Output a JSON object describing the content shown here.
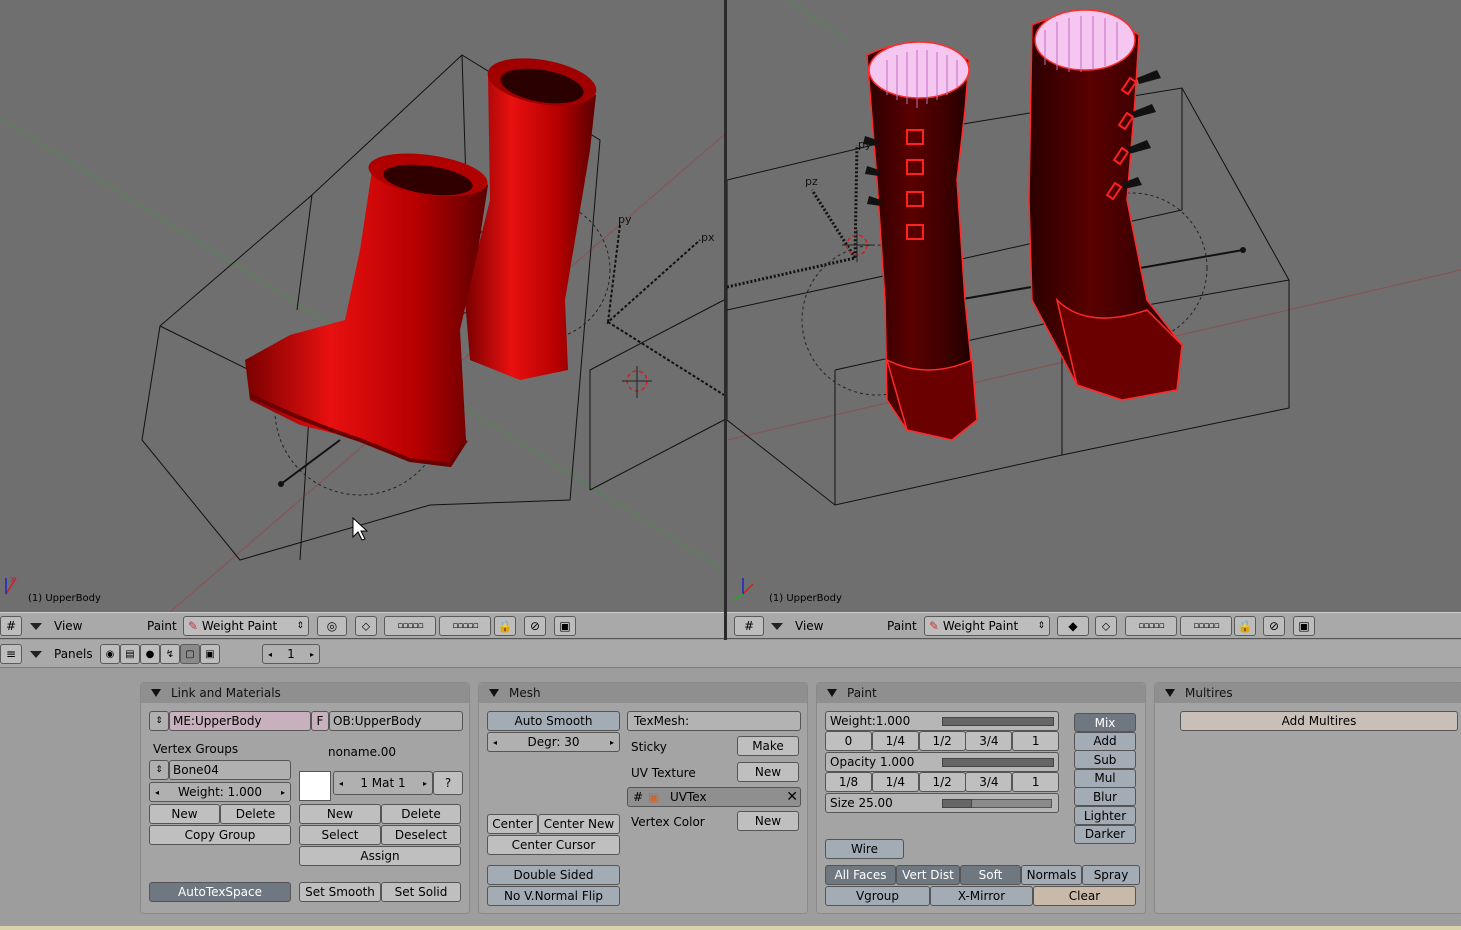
{
  "viewport_left": {
    "label": "(1) UpperBody",
    "axis_py": "py",
    "axis_px": "px"
  },
  "viewport_right": {
    "label": "(1) UpperBody",
    "axis_py": "py",
    "axis_pz": "pz"
  },
  "header_left": {
    "view": "View",
    "mode_label": "Paint",
    "mode_value": "Weight Paint"
  },
  "header_right": {
    "view": "View",
    "mode_label": "Paint",
    "mode_value": "Weight Paint"
  },
  "buttons_header": {
    "panels": "Panels",
    "frame": "1"
  },
  "link_materials": {
    "title": "Link and Materials",
    "mesh": "ME:UpperBody",
    "f": "F",
    "object": "OB:UpperBody",
    "vgroups_label": "Vertex Groups",
    "material_name": "noname.00",
    "group": "Bone04",
    "weight": "Weight: 1.000",
    "mat": "1 Mat 1",
    "q": "?",
    "new": "New",
    "delete": "Delete",
    "copy_group": "Copy Group",
    "mat_new": "New",
    "mat_delete": "Delete",
    "select": "Select",
    "deselect": "Deselect",
    "assign": "Assign",
    "autotex": "AutoTexSpace",
    "set_smooth": "Set Smooth",
    "set_solid": "Set Solid"
  },
  "mesh": {
    "title": "Mesh",
    "auto_smooth": "Auto Smooth",
    "degr": "Degr: 30",
    "texmesh": "TexMesh:",
    "sticky": "Sticky",
    "make": "Make",
    "uv_texture": "UV Texture",
    "uv_new": "New",
    "uvtex": "UVTex",
    "vertex_color": "Vertex Color",
    "vc_new": "New",
    "center": "Center",
    "center_new": "Center New",
    "center_cursor": "Center Cursor",
    "double_sided": "Double Sided",
    "no_vnormal": "No V.Normal Flip"
  },
  "paint": {
    "title": "Paint",
    "weight": "Weight:1.000",
    "weight_val": 1.0,
    "w_presets": [
      "0",
      "1/4",
      "1/2",
      "3/4",
      "1"
    ],
    "opacity": "Opacity 1.000",
    "opacity_val": 1.0,
    "o_presets": [
      "1/8",
      "1/4",
      "1/2",
      "3/4",
      "1"
    ],
    "size": "Size 25.00",
    "size_val": 0.27,
    "modes": [
      "Mix",
      "Add",
      "Sub",
      "Mul",
      "Blur",
      "Lighter",
      "Darker"
    ],
    "wire": "Wire",
    "opts": [
      "All Faces",
      "Vert Dist",
      "Soft",
      "Normals",
      "Spray"
    ],
    "vgroup": "Vgroup",
    "xmirror": "X-Mirror",
    "clear": "Clear"
  },
  "multires": {
    "title": "Multires",
    "add": "Add Multires"
  },
  "colors": {
    "viewport": "#6f6f6f",
    "boot_red": "#d40000",
    "header": "#a9a9a9"
  }
}
